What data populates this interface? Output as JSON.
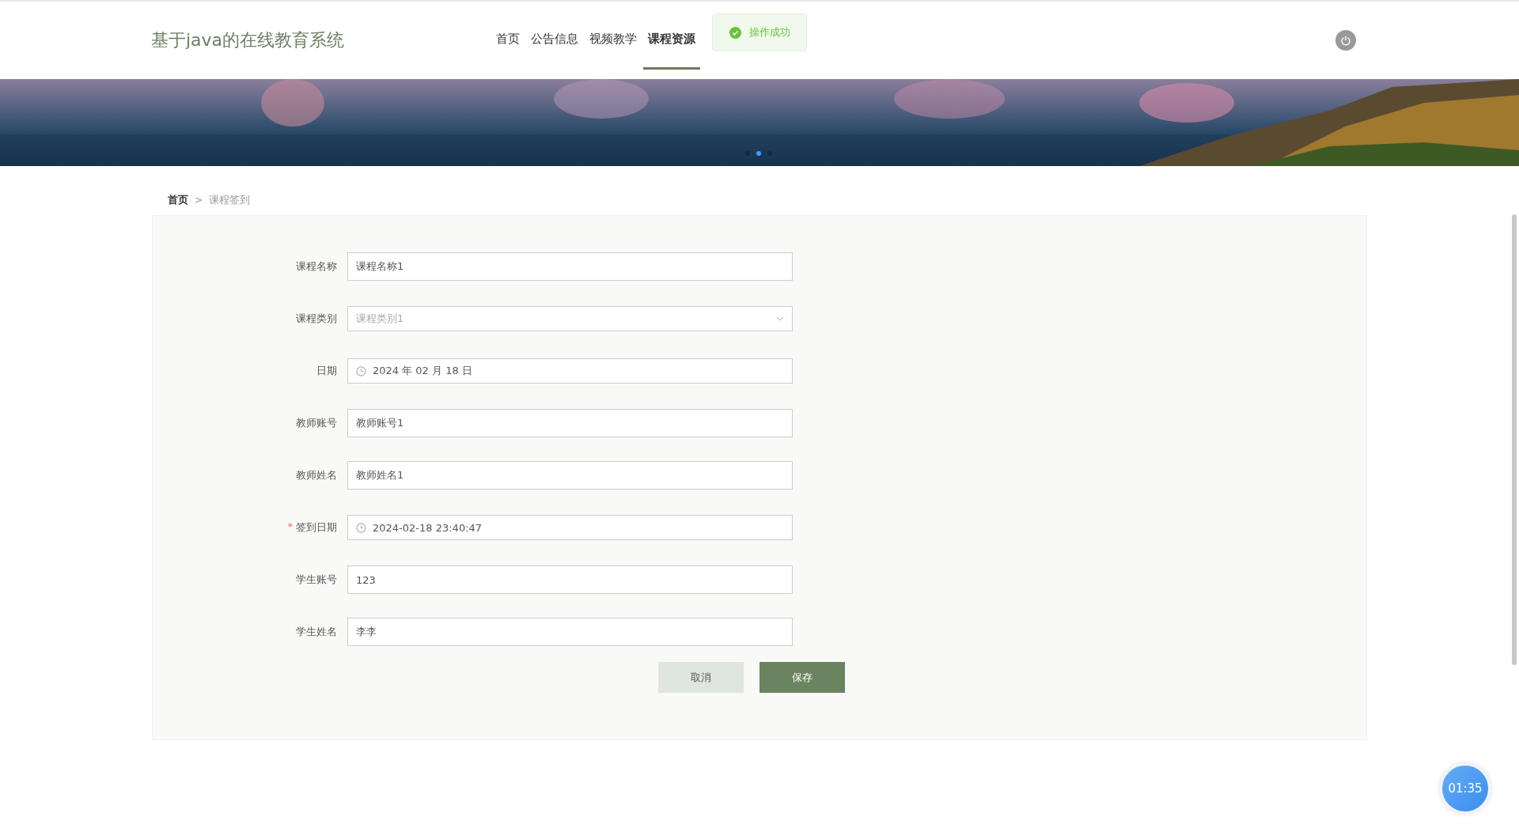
{
  "header": {
    "title": "基于java的在线教育系统",
    "nav": [
      {
        "label": "首页",
        "selected": false
      },
      {
        "label": "公告信息",
        "selected": false
      },
      {
        "label": "视频教学",
        "selected": false
      },
      {
        "label": "课程资源",
        "selected": true
      }
    ]
  },
  "toast": {
    "message": "操作成功"
  },
  "banner": {
    "kind": "picture",
    "dots": [
      {
        "selected": false
      },
      {
        "selected": true
      },
      {
        "selected": false
      }
    ]
  },
  "breadcrumb": {
    "separator": ">",
    "items": [
      "首页",
      "课程签到"
    ]
  },
  "form": {
    "required_mark": "*",
    "fields": [
      {
        "kind": "text",
        "label": "课程名称",
        "value": "课程名称1",
        "required": false,
        "disabled": false
      },
      {
        "kind": "select",
        "label": "课程类别",
        "value": "课程类别1",
        "required": false,
        "disabled": true
      },
      {
        "kind": "date",
        "label": "日期",
        "value": "2024 年 02 月 18 日",
        "required": false,
        "disabled": false
      },
      {
        "kind": "text",
        "label": "教师账号",
        "value": "教师账号1",
        "required": false,
        "disabled": false
      },
      {
        "kind": "text",
        "label": "教师姓名",
        "value": "教师姓名1",
        "required": false,
        "disabled": false
      },
      {
        "kind": "date",
        "label": "签到日期",
        "value": "2024-02-18 23:40:47",
        "required": true,
        "disabled": false
      },
      {
        "kind": "text",
        "label": "学生账号",
        "value": "123",
        "required": false,
        "disabled": false
      },
      {
        "kind": "text",
        "label": "学生姓名",
        "value": "李李",
        "required": false,
        "disabled": false
      }
    ],
    "buttons": [
      {
        "label": "取消",
        "kind": "secondary"
      },
      {
        "label": "保存",
        "kind": "primary"
      }
    ]
  },
  "timer": "01:35"
}
